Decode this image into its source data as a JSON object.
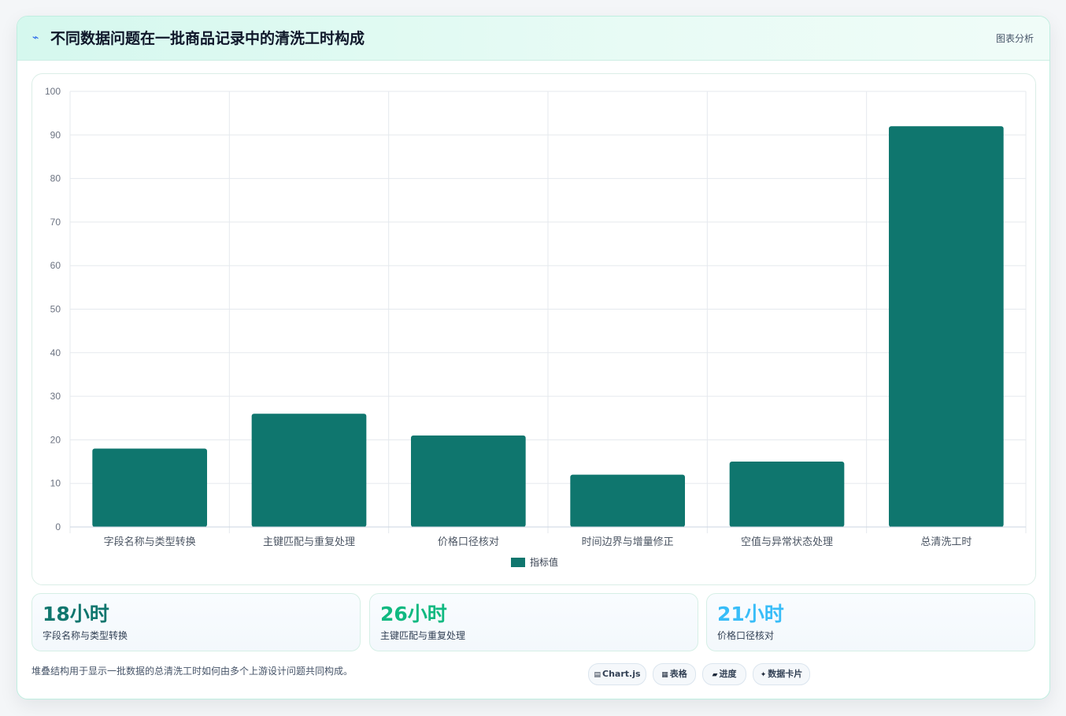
{
  "header": {
    "icon": "zigzag-icon",
    "title": "不同数据问题在一批商品记录中的清洗工时构成",
    "link": "图表分析"
  },
  "chart_data": {
    "type": "bar",
    "categories": [
      "字段名称与类型转换",
      "主键匹配与重复处理",
      "价格口径核对",
      "时间边界与增量修正",
      "空值与异常状态处理",
      "总清洗工时"
    ],
    "series": [
      {
        "name": "指标值",
        "values": [
          18,
          26,
          21,
          12,
          15,
          92
        ]
      }
    ],
    "ylim": [
      0,
      100
    ],
    "yticks": [
      0,
      10,
      20,
      30,
      40,
      50,
      60,
      70,
      80,
      90,
      100
    ],
    "grid": true,
    "legend": "bottom",
    "colors": {
      "bar": "#0f766e",
      "grid": "#e5e9ee",
      "tick": "#6b7280"
    }
  },
  "stats": [
    {
      "value": "18小时",
      "label": "字段名称与类型转换",
      "color": "#0f766e"
    },
    {
      "value": "26小时",
      "label": "主键匹配与重复处理",
      "color": "#10b981"
    },
    {
      "value": "21小时",
      "label": "价格口径核对",
      "color": "#38bdf8"
    }
  ],
  "footnote": "堆叠结构用于显示一批数据的总清洗工时如何由多个上游设计问题共同构成。",
  "tags": [
    {
      "icon": "table-icon",
      "glyph": "▤",
      "label": "Chart.js"
    },
    {
      "icon": "grid-icon",
      "glyph": "▦",
      "label": "表格"
    },
    {
      "icon": "progress-icon",
      "glyph": "▰",
      "label": "进度"
    },
    {
      "icon": "sparkle-icon",
      "glyph": "✦",
      "label": "数据卡片"
    }
  ]
}
